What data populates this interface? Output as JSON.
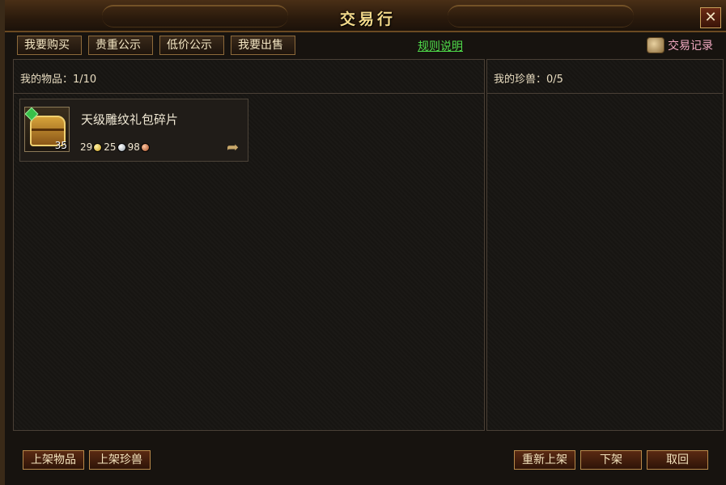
{
  "window": {
    "title": "交易行",
    "close_icon": "close-icon",
    "close_label": "✕"
  },
  "toolbar": {
    "tabs": [
      {
        "label": "我要购买"
      },
      {
        "label": "贵重公示"
      },
      {
        "label": "低价公示"
      },
      {
        "label": "我要出售"
      }
    ],
    "rules_link": "规则说明",
    "trade_log": "交易记录"
  },
  "left_panel": {
    "header": "我的物品：1/10"
  },
  "right_panel": {
    "header": "我的珍兽：0/5"
  },
  "items": [
    {
      "name": "天级雕纹礼包碎片",
      "quantity": "35",
      "price_gold": "29",
      "price_silver": "25",
      "price_copper": "98",
      "share_icon": "share-arrow-icon"
    }
  ],
  "buttons": {
    "list_item": "上架物品",
    "list_pet": "上架珍兽",
    "relist": "重新上架",
    "delist": "下架",
    "cancel": "取回"
  },
  "colors": {
    "title": "#f3d98a",
    "link": "#4fdc4a",
    "trade_log": "#f0a8c0"
  }
}
